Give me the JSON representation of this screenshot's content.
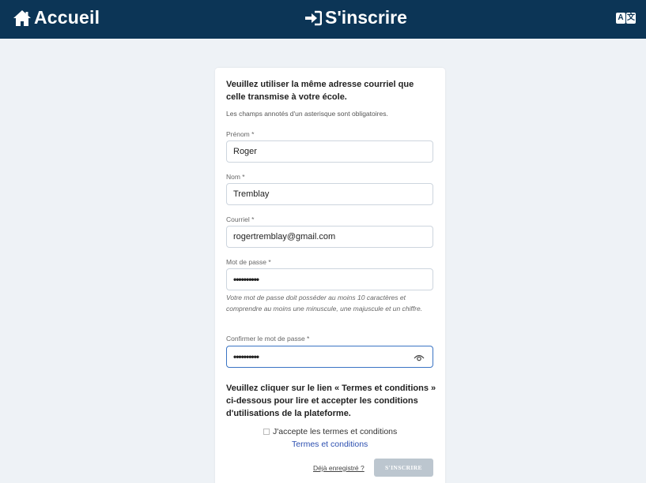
{
  "header": {
    "home_label": "Accueil",
    "title": "S'inscrire",
    "lang_a": "A",
    "lang_b": "文",
    "bg_color": "#0c3556"
  },
  "form": {
    "intro": "Veuillez utiliser la même adresse courriel que celle transmise à votre école.",
    "required_note": "Les champs annotés d'un asterisque sont obligatoires.",
    "first_name": {
      "label": "Prénom *",
      "value": "Roger"
    },
    "last_name": {
      "label": "Nom *",
      "value": "Tremblay"
    },
    "email": {
      "label": "Courriel *",
      "value": "rogertremblay@gmail.com"
    },
    "password": {
      "label": "Mot de passe *",
      "value": "••••••••••"
    },
    "password_hint": "Votre mot de passe doit posséder au moins 10 caractères et comprendre au moins une minuscule, une majuscule et un chiffre.",
    "confirm_password": {
      "label": "Confirmer le mot de passe *",
      "value": "••••••••••"
    },
    "terms_paragraph": "Veuillez cliquer sur le lien « Termes et conditions » ci-dessous pour lire et accepter les conditions d'utilisations de la plateforme.",
    "accept_label": "J'accepte les termes et conditions",
    "terms_link": "Termes et conditions",
    "already_registered": "Déjà enregistré ?",
    "submit_label": "S'INSCRIRE"
  },
  "icons": [
    "home-icon",
    "sign-in-icon",
    "translate-icon",
    "eye-icon"
  ],
  "colors": {
    "accent": "#3a74c4",
    "link": "#2c4fb0",
    "submit_disabled": "#bcc6cf"
  }
}
